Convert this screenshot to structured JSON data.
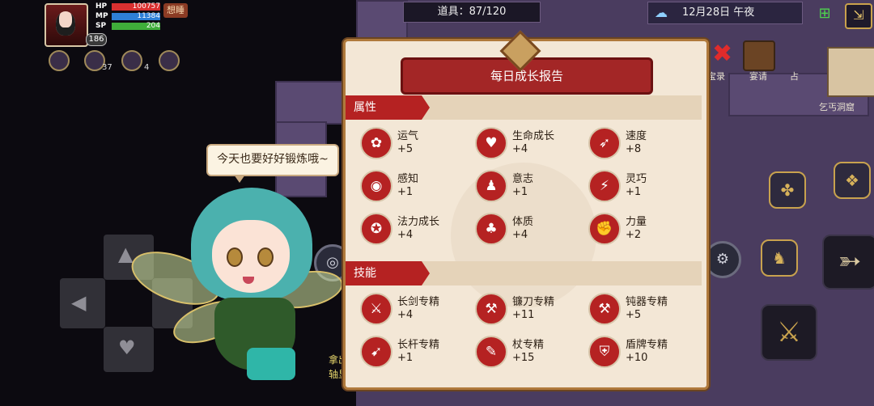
{
  "hud": {
    "level": "186",
    "stats": [
      {
        "label": "HP",
        "value": "100757",
        "color": "#d93030",
        "fill": 1.0
      },
      {
        "label": "MP",
        "value": "11384",
        "color": "#2e7fd6",
        "fill": 1.0
      },
      {
        "label": "SP",
        "value": "204",
        "color": "#3fae3a",
        "fill": 1.0
      }
    ],
    "status_tag": "想睡",
    "buff_counts": [
      "37",
      "4"
    ]
  },
  "topbar": {
    "items": "道具：87/120",
    "date": "12月28日",
    "time_of_day": "午夜"
  },
  "side": {
    "treasure_label": "宝录",
    "invite_label": "宴请",
    "partial_label": "占",
    "cave_label": "乞丐洞窟"
  },
  "bubble": {
    "text": "今天也要好好锻炼哦~"
  },
  "panel": {
    "title": "每日成长报告",
    "attributes_label": "属性",
    "skills_label": "技能",
    "attributes": [
      {
        "name": "运气",
        "value": "+5",
        "icon": "clover-icon",
        "glyph": "✿"
      },
      {
        "name": "生命成长",
        "value": "+4",
        "icon": "heart-icon",
        "glyph": "♥"
      },
      {
        "name": "速度",
        "value": "+8",
        "icon": "wing-icon",
        "glyph": "➶"
      },
      {
        "name": "感知",
        "value": "+1",
        "icon": "eye-icon",
        "glyph": "◉"
      },
      {
        "name": "意志",
        "value": "+1",
        "icon": "figure-icon",
        "glyph": "♟"
      },
      {
        "name": "灵巧",
        "value": "+1",
        "icon": "runner-icon",
        "glyph": "⚡"
      },
      {
        "name": "法力成长",
        "value": "+4",
        "icon": "magic-star-icon",
        "glyph": "✪"
      },
      {
        "name": "体质",
        "value": "+4",
        "icon": "body-icon",
        "glyph": "♣"
      },
      {
        "name": "力量",
        "value": "+2",
        "icon": "arm-icon",
        "glyph": "✊"
      }
    ],
    "skills": [
      {
        "name": "长剑专精",
        "value": "+4",
        "icon": "sword-icon",
        "glyph": "⚔"
      },
      {
        "name": "镰刀专精",
        "value": "+11",
        "icon": "axe-icon",
        "glyph": "⚒"
      },
      {
        "name": "钝器专精",
        "value": "+5",
        "icon": "hammer-icon",
        "glyph": "⚒"
      },
      {
        "name": "长杆专精",
        "value": "+1",
        "icon": "spear-icon",
        "glyph": "➹"
      },
      {
        "name": "杖专精",
        "value": "+15",
        "icon": "staff-icon",
        "glyph": "✎"
      },
      {
        "name": "盾牌专精",
        "value": "+10",
        "icon": "shield-icon",
        "glyph": "⛨"
      }
    ]
  },
  "behind": {
    "text1": "拿出",
    "text2": "轴显著"
  },
  "colors": {
    "accent_red": "#b52222",
    "panel_bg": "#f3e7d6",
    "gold": "#c8a24e"
  }
}
